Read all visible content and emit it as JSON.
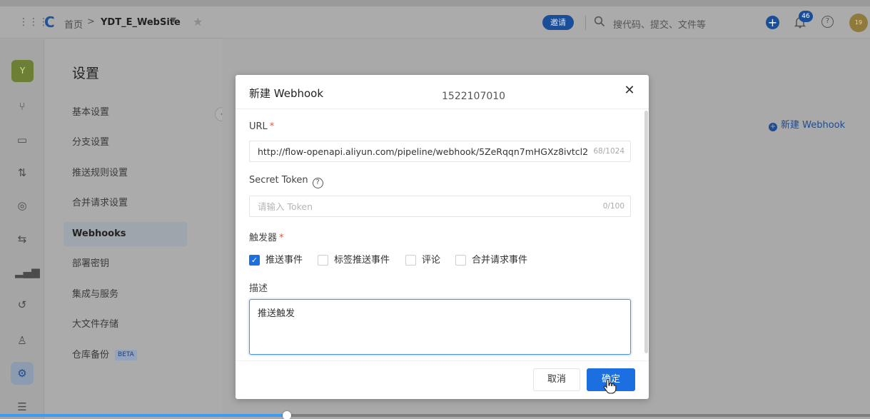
{
  "header": {
    "breadcrumb_home": "首页",
    "breadcrumb_sep": ">",
    "repo_name": "YDT_E_WebSite",
    "invite_label": "邀请",
    "search_placeholder": "搜代码、提交、文件等",
    "notification_count": "46",
    "user_avatar_text": "19"
  },
  "rail": {
    "project_avatar": "Y",
    "icons": [
      "branch-icon",
      "tag-icon",
      "merge-request-icon",
      "pipeline-icon",
      "compare-icon",
      "stats-icon",
      "history-icon",
      "member-icon",
      "settings-icon",
      "menu-icon"
    ]
  },
  "settings": {
    "title": "设置",
    "menu": [
      {
        "label": "基本设置"
      },
      {
        "label": "分支设置"
      },
      {
        "label": "推送规则设置"
      },
      {
        "label": "合并请求设置"
      },
      {
        "label": "Webhooks",
        "active": true
      },
      {
        "label": "部署密钥"
      },
      {
        "label": "集成与服务"
      },
      {
        "label": "大文件存储"
      },
      {
        "label": "仓库备份",
        "badge": "BETA"
      }
    ]
  },
  "main": {
    "new_webhook_link": "新建 Webhook"
  },
  "modal": {
    "title": "新建 Webhook",
    "overlay_id": "1522107010",
    "url_label": "URL",
    "required_mark": "*",
    "url_value": "http://flow-openapi.aliyun.com/pipeline/webhook/5ZeRqqn7mHGXz8ivtcl2",
    "url_counter": "68/1024",
    "token_label": "Secret Token",
    "token_placeholder": "请输入 Token",
    "token_counter": "0/100",
    "trigger_label": "触发器",
    "triggers": [
      {
        "label": "推送事件",
        "checked": true
      },
      {
        "label": "标签推送事件",
        "checked": false
      },
      {
        "label": "评论",
        "checked": false
      },
      {
        "label": "合并请求事件",
        "checked": false
      }
    ],
    "desc_label": "描述",
    "desc_value": "推送触发",
    "cancel_label": "取消",
    "ok_label": "确定"
  },
  "video_progress": 0.33,
  "colors": {
    "primary": "#1b6fe0",
    "overlay_brand": "#1b4e98",
    "required": "#e5533a"
  }
}
